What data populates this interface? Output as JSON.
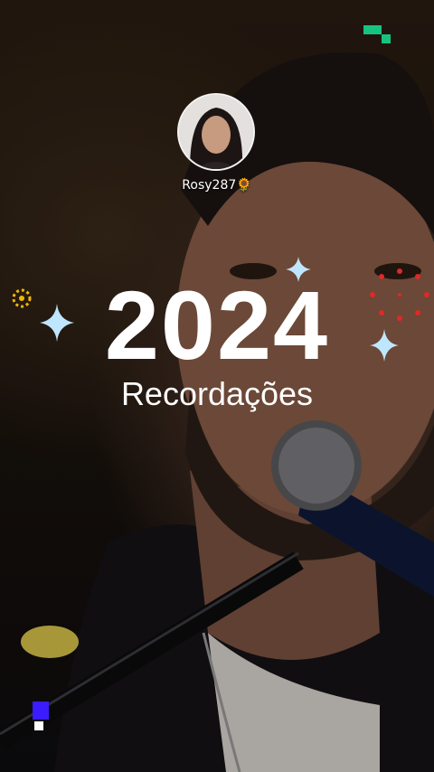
{
  "story": {
    "username": "Rosy287🌻",
    "year": "2024",
    "subtitle": "Recordações"
  },
  "colors": {
    "sparkle": "#bfe6ff",
    "burst_red": "#e02828",
    "ring_yellow": "#f2b705",
    "pixel_green": "#16c47f",
    "pixel_blue": "#3a1cff"
  },
  "icons": [
    "sparkle-icon",
    "firework-icon",
    "flower-ring-icon",
    "pixel-block-icon"
  ]
}
